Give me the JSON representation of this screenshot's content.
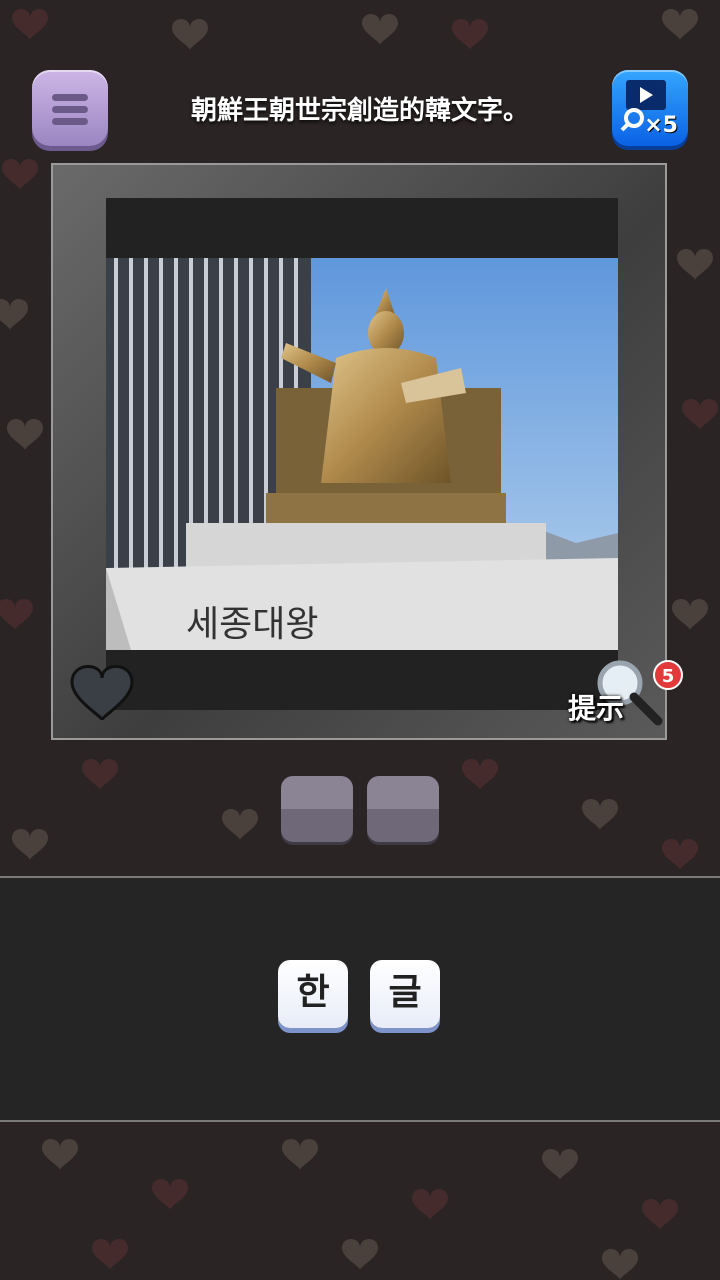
{
  "question": "朝鮮王朝世宗創造的韓文字。",
  "video_button": {
    "icon": "video-magnifier-icon",
    "multiplier": "×5"
  },
  "menu_button": {
    "icon": "hamburger-icon"
  },
  "photo": {
    "subject": "statue-photo",
    "plaque_text": "세종대왕"
  },
  "hint": {
    "label": "提示",
    "count": "5",
    "icon": "magnifier-icon"
  },
  "answer_slots": [
    "",
    ""
  ],
  "letters": [
    "한",
    "글"
  ],
  "colors": {
    "background": "#2a2424",
    "accent": "#9c86c2",
    "video": "#0b62e4",
    "badge": "#e23a3a"
  }
}
